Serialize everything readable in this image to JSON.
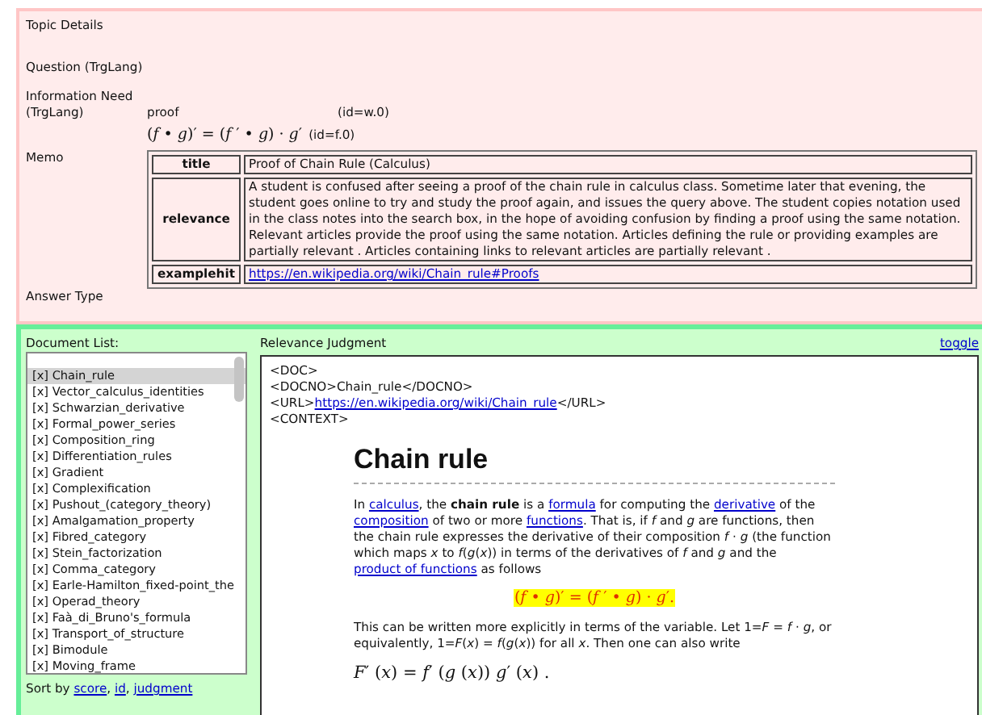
{
  "topic": {
    "heading": "Topic Details",
    "fields": [
      {
        "kind": "empty",
        "label": "Question (TrgLang)"
      },
      {
        "kind": "need",
        "label": "Information Need (TrgLang)",
        "keyword": {
          "text": "proof",
          "id": "(id=w.0)"
        },
        "formula": {
          "text": "(*f* • *g*)′ = (*f* ′ • *g*) · *g*′",
          "id": "(id=f.0)"
        }
      },
      {
        "kind": "memo",
        "label": "Memo",
        "rows": [
          {
            "key": "title",
            "value": "Proof of Chain Rule (Calculus)"
          },
          {
            "key": "relevance",
            "value": "A student is confused after seeing a proof of the chain rule in calculus class. Sometime later that evening, the student goes online to try and study the proof again, and issues the query above. The student copies notation used in the class notes into the search box, in the hope of avoiding confusion by finding a proof using the same notation. Relevant articles provide the proof using the same notation. Articles defining the rule or providing examples are partially relevant . Articles containing links to relevant articles are partially relevant ."
          },
          {
            "key": "examplehit",
            "value": "https://en.wikipedia.org/wiki/Chain_rule#Proofs",
            "kind": "link"
          }
        ]
      },
      {
        "kind": "empty",
        "label": "Answer Type"
      }
    ]
  },
  "document_list": {
    "heading": "Document List:",
    "items": [
      {
        "label": "[x] Chain_rule",
        "selected": true
      },
      {
        "label": "[x] Vector_calculus_identities",
        "selected": false
      },
      {
        "label": "[x] Schwarzian_derivative",
        "selected": false
      },
      {
        "label": "[x] Formal_power_series",
        "selected": false
      },
      {
        "label": "[x] Composition_ring",
        "selected": false
      },
      {
        "label": "[x] Differentiation_rules",
        "selected": false
      },
      {
        "label": "[x] Gradient",
        "selected": false
      },
      {
        "label": "[x] Complexification",
        "selected": false
      },
      {
        "label": "[x] Pushout_(category_theory)",
        "selected": false
      },
      {
        "label": "[x] Amalgamation_property",
        "selected": false
      },
      {
        "label": "[x] Fibred_category",
        "selected": false
      },
      {
        "label": "[x] Stein_factorization",
        "selected": false
      },
      {
        "label": "[x] Comma_category",
        "selected": false
      },
      {
        "label": "[x] Earle-Hamilton_fixed-point_the",
        "selected": false
      },
      {
        "label": "[x] Operad_theory",
        "selected": false
      },
      {
        "label": "[x] Faà_di_Bruno's_formula",
        "selected": false
      },
      {
        "label": "[x] Transport_of_structure",
        "selected": false
      },
      {
        "label": "[x] Bimodule",
        "selected": false
      },
      {
        "label": "[x] Moving_frame",
        "selected": false
      }
    ],
    "sort_label": "Sort by",
    "sort_separator": ",",
    "sort_links": [
      "score",
      "id",
      "judgment"
    ]
  },
  "judgment": {
    "heading": "Relevance Judgment",
    "toggle": "toggle",
    "header_lines": [
      {
        "kind": "text",
        "text": "<DOC>"
      },
      {
        "kind": "text",
        "text": "<DOCNO>Chain_rule</DOCNO>"
      },
      {
        "kind": "url",
        "prefix": "<URL>",
        "link": "https://en.wikipedia.org/wiki/Chain_rule",
        "suffix": "</URL>"
      },
      {
        "kind": "text",
        "text": "<CONTEXT>"
      }
    ],
    "article": {
      "title": "Chain rule",
      "blocks": [
        {
          "kind": "paragraph",
          "segments": [
            {
              "text": "In ",
              "kind": "text"
            },
            {
              "text": "calculus",
              "kind": "link"
            },
            {
              "text": ", the **chain rule** is a ",
              "kind": "text"
            },
            {
              "text": "formula",
              "kind": "link"
            },
            {
              "text": " for computing the ",
              "kind": "text"
            },
            {
              "text": "derivative",
              "kind": "link"
            },
            {
              "text": " of the ",
              "kind": "text"
            },
            {
              "text": "composition",
              "kind": "link"
            },
            {
              "text": " of two or more ",
              "kind": "text"
            },
            {
              "text": "functions",
              "kind": "link"
            },
            {
              "text": ". That is, if *f* and *g* are functions, then the chain rule expresses the derivative of their composition *f* · *g* (the function which maps *x* to *f*(*g*(*x*)) in terms of the derivatives of *f* and *g* and the ",
              "kind": "text"
            },
            {
              "text": "product of functions",
              "kind": "link"
            },
            {
              "text": " as follows",
              "kind": "text"
            }
          ]
        },
        {
          "kind": "highlight-formula",
          "text": "(*f* • *g*)′ = (*f* ′ • *g*) · *g*′."
        },
        {
          "kind": "paragraph",
          "segments": [
            {
              "text": "This can be written more explicitly in terms of the variable. Let 1=*F* = *f* · *g*, or equivalently, 1=*F*(*x*) = *f*(*g*(*x*)) for all *x*. Then one can also write",
              "kind": "text"
            }
          ]
        },
        {
          "kind": "formula",
          "text": "*F*′ (*x*) = *f*′ (*g* (*x*)) *g*′ (*x*) ."
        }
      ]
    }
  }
}
